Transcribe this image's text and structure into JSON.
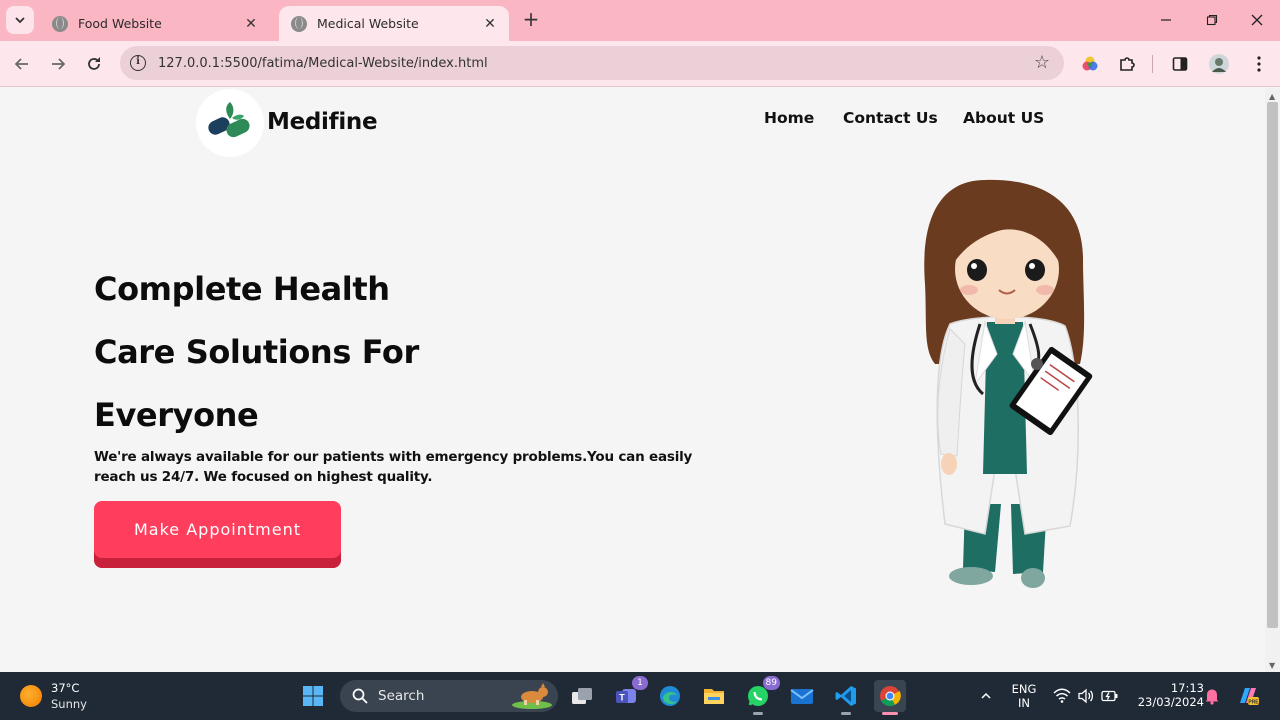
{
  "browser": {
    "tabs": [
      {
        "title": "Food Website",
        "active": false
      },
      {
        "title": "Medical Website",
        "active": true
      }
    ],
    "url": "127.0.0.1:5500/fatima/Medical-Website/index.html"
  },
  "site": {
    "brand": "Medifine",
    "nav": [
      "Home",
      "Contact Us",
      "About US"
    ],
    "hero": {
      "title_lines": [
        "Complete Health",
        "Care Solutions For",
        "Everyone"
      ],
      "text": "We're always available for our patients with emergency problems.You can easily reach us 24/7. We focused on highest quality.",
      "cta": "Make Appointment"
    }
  },
  "taskbar": {
    "weather": {
      "temp": "37°C",
      "condition": "Sunny"
    },
    "search_label": "Search",
    "badges": {
      "teams": "1",
      "whatsapp": "89"
    },
    "language": {
      "line1": "ENG",
      "line2": "IN"
    },
    "clock": {
      "time": "17:13",
      "date": "23/03/2024"
    }
  },
  "colors": {
    "chrome": "#fbb6c4",
    "toolbar": "#fde7ec",
    "cta": "#ff3d5c",
    "page": "#f5f5f5",
    "taskbar": "#202a36"
  }
}
